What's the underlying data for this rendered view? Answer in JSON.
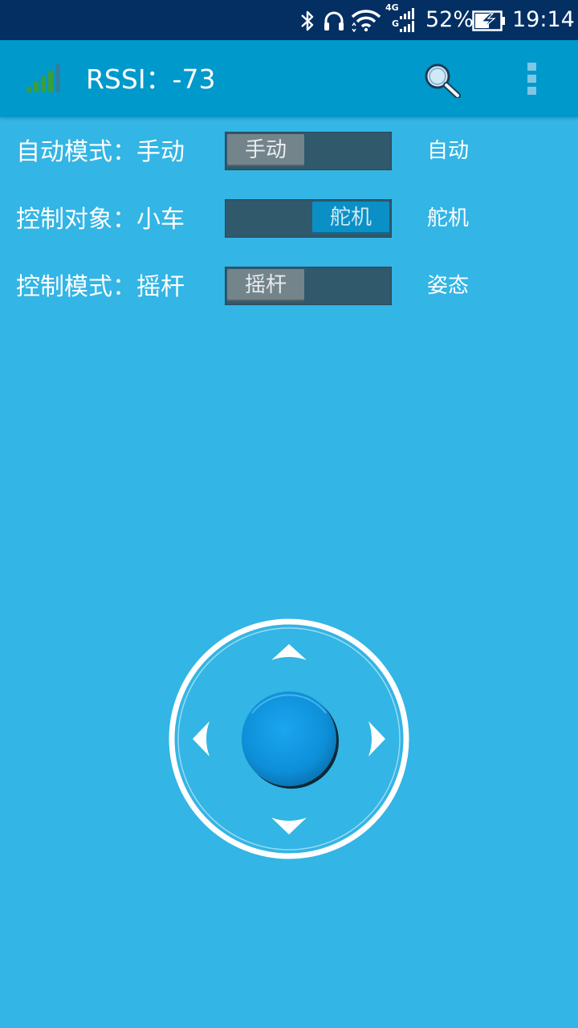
{
  "status_bar": {
    "network_label_top": "4G",
    "network_label_bottom": "G",
    "battery_percent": "52%",
    "time": "19:14",
    "icons": [
      "bluetooth-icon",
      "headphones-icon",
      "wifi-icon",
      "cellular-icon",
      "battery-charging-icon"
    ]
  },
  "app_bar": {
    "rssi_text": "RSSI：-73",
    "icons": [
      "signal-strength-icon",
      "search-icon",
      "overflow-menu-icon"
    ]
  },
  "controls": [
    {
      "label": "自动模式：手动",
      "switch_text": "手动",
      "switch_on": false,
      "alt_text": "自动"
    },
    {
      "label": "控制对象：小车",
      "switch_text": "舵机",
      "switch_on": true,
      "alt_text": "舵机"
    },
    {
      "label": "控制模式：摇杆",
      "switch_text": "摇杆",
      "switch_on": false,
      "alt_text": "姿态"
    }
  ],
  "joystick": {
    "icons": [
      "arrow-up-icon",
      "arrow-down-icon",
      "arrow-left-icon",
      "arrow-right-icon",
      "joystick-knob"
    ]
  },
  "colors": {
    "background": "#33b5e5",
    "app_bar": "#0099cc",
    "status_bar": "#032f63",
    "switch_track": "#30596c",
    "switch_thumb_off": "#74848b",
    "switch_thumb_on": "#0b90c6"
  }
}
